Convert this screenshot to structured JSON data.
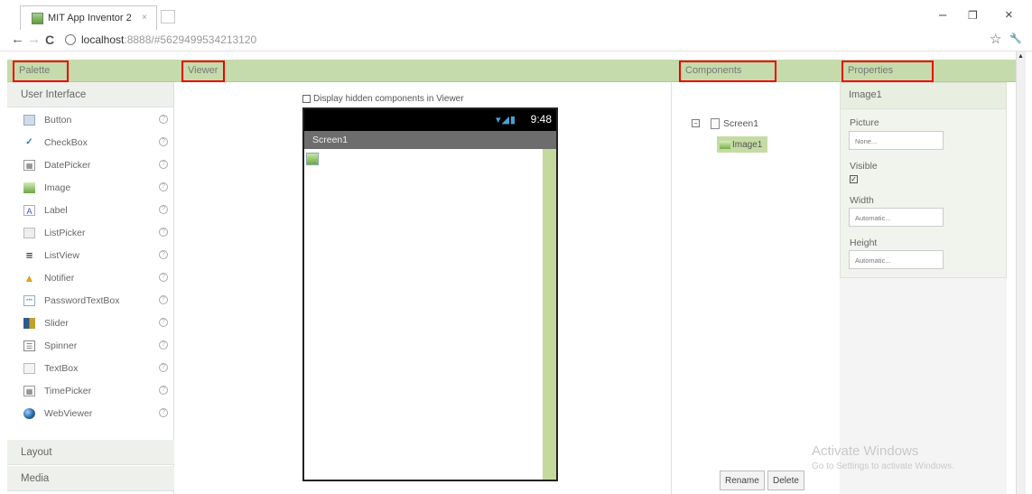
{
  "browser": {
    "tab_title": "MIT App Inventor 2",
    "tab_close": "×",
    "url_host": "localhost",
    "url_rest": ":8888/#5629499534213120",
    "nav": {
      "back": "←",
      "forward": "→",
      "reload": "C"
    },
    "window_controls": {
      "minimize": "–",
      "restore": "❐",
      "close": "×"
    },
    "toolbar_icons": {
      "star": "☆",
      "wrench": "🔧"
    }
  },
  "headers": {
    "palette": "Palette",
    "viewer": "Viewer",
    "components": "Components",
    "properties": "Properties"
  },
  "palette": {
    "category_open": "User Interface",
    "items": [
      {
        "label": "Button",
        "icon": "button-icon"
      },
      {
        "label": "CheckBox",
        "icon": "checkbox-icon"
      },
      {
        "label": "DatePicker",
        "icon": "datepicker-icon"
      },
      {
        "label": "Image",
        "icon": "image-icon"
      },
      {
        "label": "Label",
        "icon": "label-icon"
      },
      {
        "label": "ListPicker",
        "icon": "listpicker-icon"
      },
      {
        "label": "ListView",
        "icon": "listview-icon"
      },
      {
        "label": "Notifier",
        "icon": "notifier-icon"
      },
      {
        "label": "PasswordTextBox",
        "icon": "password-icon"
      },
      {
        "label": "Slider",
        "icon": "slider-icon"
      },
      {
        "label": "Spinner",
        "icon": "spinner-icon"
      },
      {
        "label": "TextBox",
        "icon": "textbox-icon"
      },
      {
        "label": "TimePicker",
        "icon": "timepicker-icon"
      },
      {
        "label": "WebViewer",
        "icon": "webviewer-icon"
      }
    ],
    "help_glyph": "?",
    "category_layout": "Layout",
    "category_media": "Media"
  },
  "viewer": {
    "hidden_components_label": "Display hidden components in Viewer",
    "hidden_components_checked": false,
    "status_time": "9:48",
    "screen_title": "Screen1"
  },
  "components": {
    "tree_toggle": "⊟",
    "root": "Screen1",
    "child": "Image1",
    "rename_label": "Rename",
    "delete_label": "Delete"
  },
  "properties": {
    "component": "Image1",
    "picture_label": "Picture",
    "picture_value": "None...",
    "visible_label": "Visible",
    "visible_checked": true,
    "width_label": "Width",
    "width_value": "Automatic...",
    "height_label": "Height",
    "height_value": "Automatic..."
  },
  "watermark": {
    "line1": "Activate Windows",
    "line2": "Go to Settings to activate Windows."
  },
  "colors": {
    "header_band": "#c5dbab",
    "highlight_box": "#e00000",
    "selected_component": "#c5dba4"
  }
}
